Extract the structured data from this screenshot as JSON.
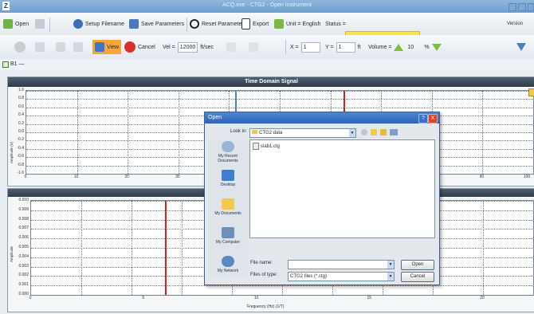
{
  "window": {
    "title": "ACQ.exe - CTG2 - Open Instrument",
    "app_glyph": "Z"
  },
  "toolbar1": {
    "open_label": "Open",
    "setup_label": "Setup Filename",
    "save_params_label": "Save Parameters",
    "reset_params_label": "Reset Parameter",
    "export_label": "Export",
    "unit_label": "Unit = English",
    "status_label": "Status =",
    "status_value": "",
    "version_label": "Version"
  },
  "toolbar2": {
    "view_label": "View",
    "cancel_label": "Cancel",
    "vel_label": "Vel =",
    "vel_value": "12000",
    "vel_unit": "ft/sec",
    "x_label": "X =",
    "x_value": "1",
    "y_label": "Y =",
    "y_value": "1",
    "xy_unit": "ft",
    "volume_label": "Volume =",
    "volume_value": "10",
    "volume_unit": "%"
  },
  "subbar": {
    "label": "B1 —"
  },
  "chart_time": {
    "title": "Time Domain Signal",
    "ylabel": "Amplitude (V)",
    "yticks": [
      "1.0",
      "0.8",
      "0.6",
      "0.4",
      "0.2",
      "0.0",
      "-0.2",
      "-0.4",
      "-0.6",
      "-0.8",
      "-1.0"
    ],
    "xticks": [
      "0",
      "10",
      "20",
      "30",
      "90",
      "100"
    ]
  },
  "chart_freq": {
    "ylabel": "Amplitude",
    "xlabel": "Frequency (Hz) (1/T)",
    "yticks": [
      "0.010",
      "0.009",
      "0.008",
      "0.007",
      "0.006",
      "0.005",
      "0.004",
      "0.003",
      "0.002",
      "0.001",
      "0.000"
    ],
    "xticks": [
      "0",
      "5",
      "10",
      "15",
      "20"
    ]
  },
  "dialog": {
    "title": "Open",
    "look_in_label": "Look in:",
    "look_in_value": "CTG2 data",
    "files": [
      "slab1.ctg"
    ],
    "places": [
      "My Recent Documents",
      "Desktop",
      "My Documents",
      "My Computer",
      "My Network"
    ],
    "filename_label": "File name:",
    "filename_value": "",
    "filetype_label": "Files of type:",
    "filetype_value": "CTG2 files (*.ctg)",
    "open_button": "Open",
    "cancel_button": "Cancel",
    "help_button": "?",
    "close_button": "X"
  },
  "colors": {
    "accent": "#2d64b3",
    "status_yellow": "#f1ea4a",
    "marker_red": "#d12222",
    "marker_blue": "#4d7fd6"
  }
}
